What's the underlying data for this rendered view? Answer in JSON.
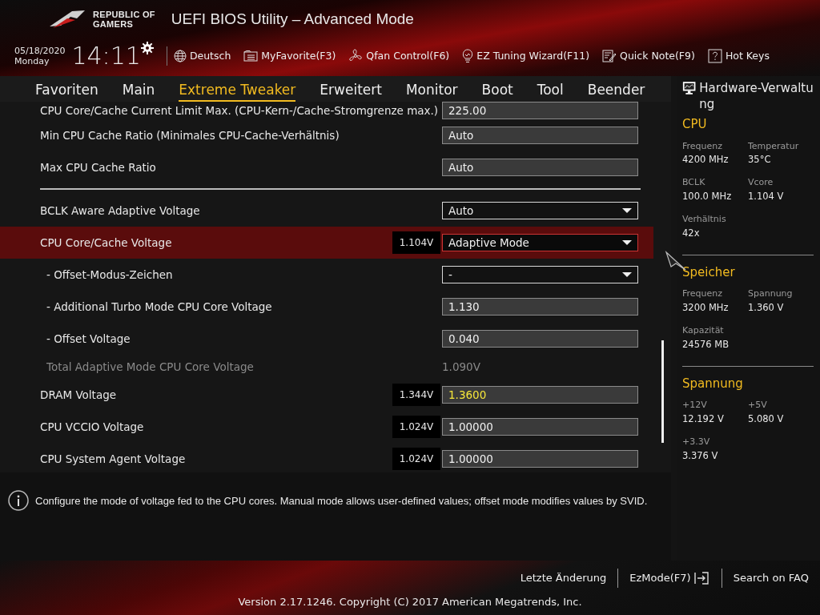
{
  "window": {
    "title": "UEFI BIOS Utility – Advanced Mode"
  },
  "logo": {
    "line_1": "REPUBLIC OF",
    "line_2": "GAMERS"
  },
  "clock": {
    "date": "05/18/2020",
    "day": "Monday",
    "time": "14:11"
  },
  "toolbar": [
    {
      "label": "Deutsch",
      "kind": "globe"
    },
    {
      "label": "MyFavorite(F3)",
      "kind": "list"
    },
    {
      "label": "Qfan Control(F6)",
      "kind": "fan"
    },
    {
      "label": "EZ Tuning Wizard(F11)",
      "kind": "bulb"
    },
    {
      "label": "Quick Note(F9)",
      "kind": "note"
    },
    {
      "label": "Hot Keys",
      "kind": "help"
    }
  ],
  "tabs": [
    {
      "label": "Favoriten",
      "selected": false
    },
    {
      "label": "Main",
      "selected": false
    },
    {
      "label": "Extreme Tweaker",
      "selected": true
    },
    {
      "label": "Erweitert",
      "selected": false
    },
    {
      "label": "Monitor",
      "selected": false
    },
    {
      "label": "Boot",
      "selected": false
    },
    {
      "label": "Tool",
      "selected": false
    },
    {
      "label": "Beender",
      "selected": false
    }
  ],
  "settings": [
    {
      "kind": "field",
      "label": "CPU Core/Cache Current Limit Max. (CPU-Kern-/Cache-Stromgrenze max.)",
      "value": "225.00",
      "selected": false,
      "changed": false
    },
    {
      "kind": "field",
      "label": "Min CPU Cache Ratio (Minimales CPU-Cache-Verhältnis)",
      "value": "Auto",
      "selected": false,
      "changed": false
    },
    {
      "kind": "field",
      "label": "Max CPU Cache Ratio",
      "value": "Auto",
      "selected": false,
      "changed": false
    },
    {
      "kind": "separator"
    },
    {
      "kind": "dropdown",
      "label": "BCLK Aware Adaptive Voltage",
      "value": "Auto",
      "selected": false,
      "changed": false
    },
    {
      "kind": "dropdown",
      "label": "CPU Core/Cache Voltage",
      "reading": "1.104V",
      "value": "Adaptive Mode",
      "selected": true,
      "changed": false,
      "children": [
        {
          "kind": "dropdown",
          "label": "- Offset-Modus-Zeichen",
          "value": "-",
          "selected": false,
          "changed": false
        },
        {
          "kind": "field",
          "label": "- Additional Turbo Mode CPU Core Voltage",
          "value": "1.130",
          "selected": false,
          "changed": false
        },
        {
          "kind": "field",
          "label": "- Offset Voltage",
          "value": "0.040",
          "selected": false,
          "changed": false
        },
        {
          "kind": "info",
          "label": "Total Adaptive Mode CPU Core Voltage",
          "value": "1.090V",
          "selected": false
        }
      ]
    },
    {
      "kind": "field",
      "label": "DRAM Voltage",
      "reading": "1.344V",
      "value": "1.3600",
      "selected": false,
      "changed": true
    },
    {
      "kind": "field",
      "label": "CPU VCCIO Voltage",
      "reading": "1.024V",
      "value": "1.00000",
      "selected": false,
      "changed": false
    },
    {
      "kind": "field",
      "label": "CPU System Agent Voltage",
      "reading": "1.024V",
      "value": "1.00000",
      "selected": false,
      "changed": false
    }
  ],
  "hardware_monitor": {
    "title": "Hardware-Verwaltung",
    "sections": [
      {
        "title": "CPU",
        "items": [
          {
            "label": "Frequenz",
            "value": "4200 MHz"
          },
          {
            "label": "Temperatur",
            "value": "35°C"
          },
          {
            "label": "BCLK",
            "value": "100.0 MHz"
          },
          {
            "label": "Vcore",
            "value": "1.104 V"
          },
          {
            "label": "Verhältnis",
            "value": "42x"
          }
        ]
      },
      {
        "title": "Speicher",
        "items": [
          {
            "label": "Frequenz",
            "value": "3200 MHz"
          },
          {
            "label": "Spannung",
            "value": "1.360 V"
          },
          {
            "label": "Kapazität",
            "value": "24576 MB"
          }
        ]
      },
      {
        "title": "Spannung",
        "items": [
          {
            "label": "+12V",
            "value": "12.192 V"
          },
          {
            "label": "+5V",
            "value": "5.080 V"
          },
          {
            "label": "+3.3V",
            "value": "3.376 V"
          }
        ]
      }
    ]
  },
  "help": {
    "text": "Configure the mode of voltage fed to the CPU cores. Manual mode allows user-defined values; offset mode modifies values by SVID."
  },
  "footer": {
    "links": [
      {
        "label": "Letzte Änderung",
        "kind": "plain"
      },
      {
        "label": "EzMode(F7)",
        "kind": "exit"
      },
      {
        "label": "Search on FAQ",
        "kind": "plain"
      }
    ],
    "version": "Version 2.17.1246. Copyright (C) 2017 American Megatrends, Inc."
  }
}
